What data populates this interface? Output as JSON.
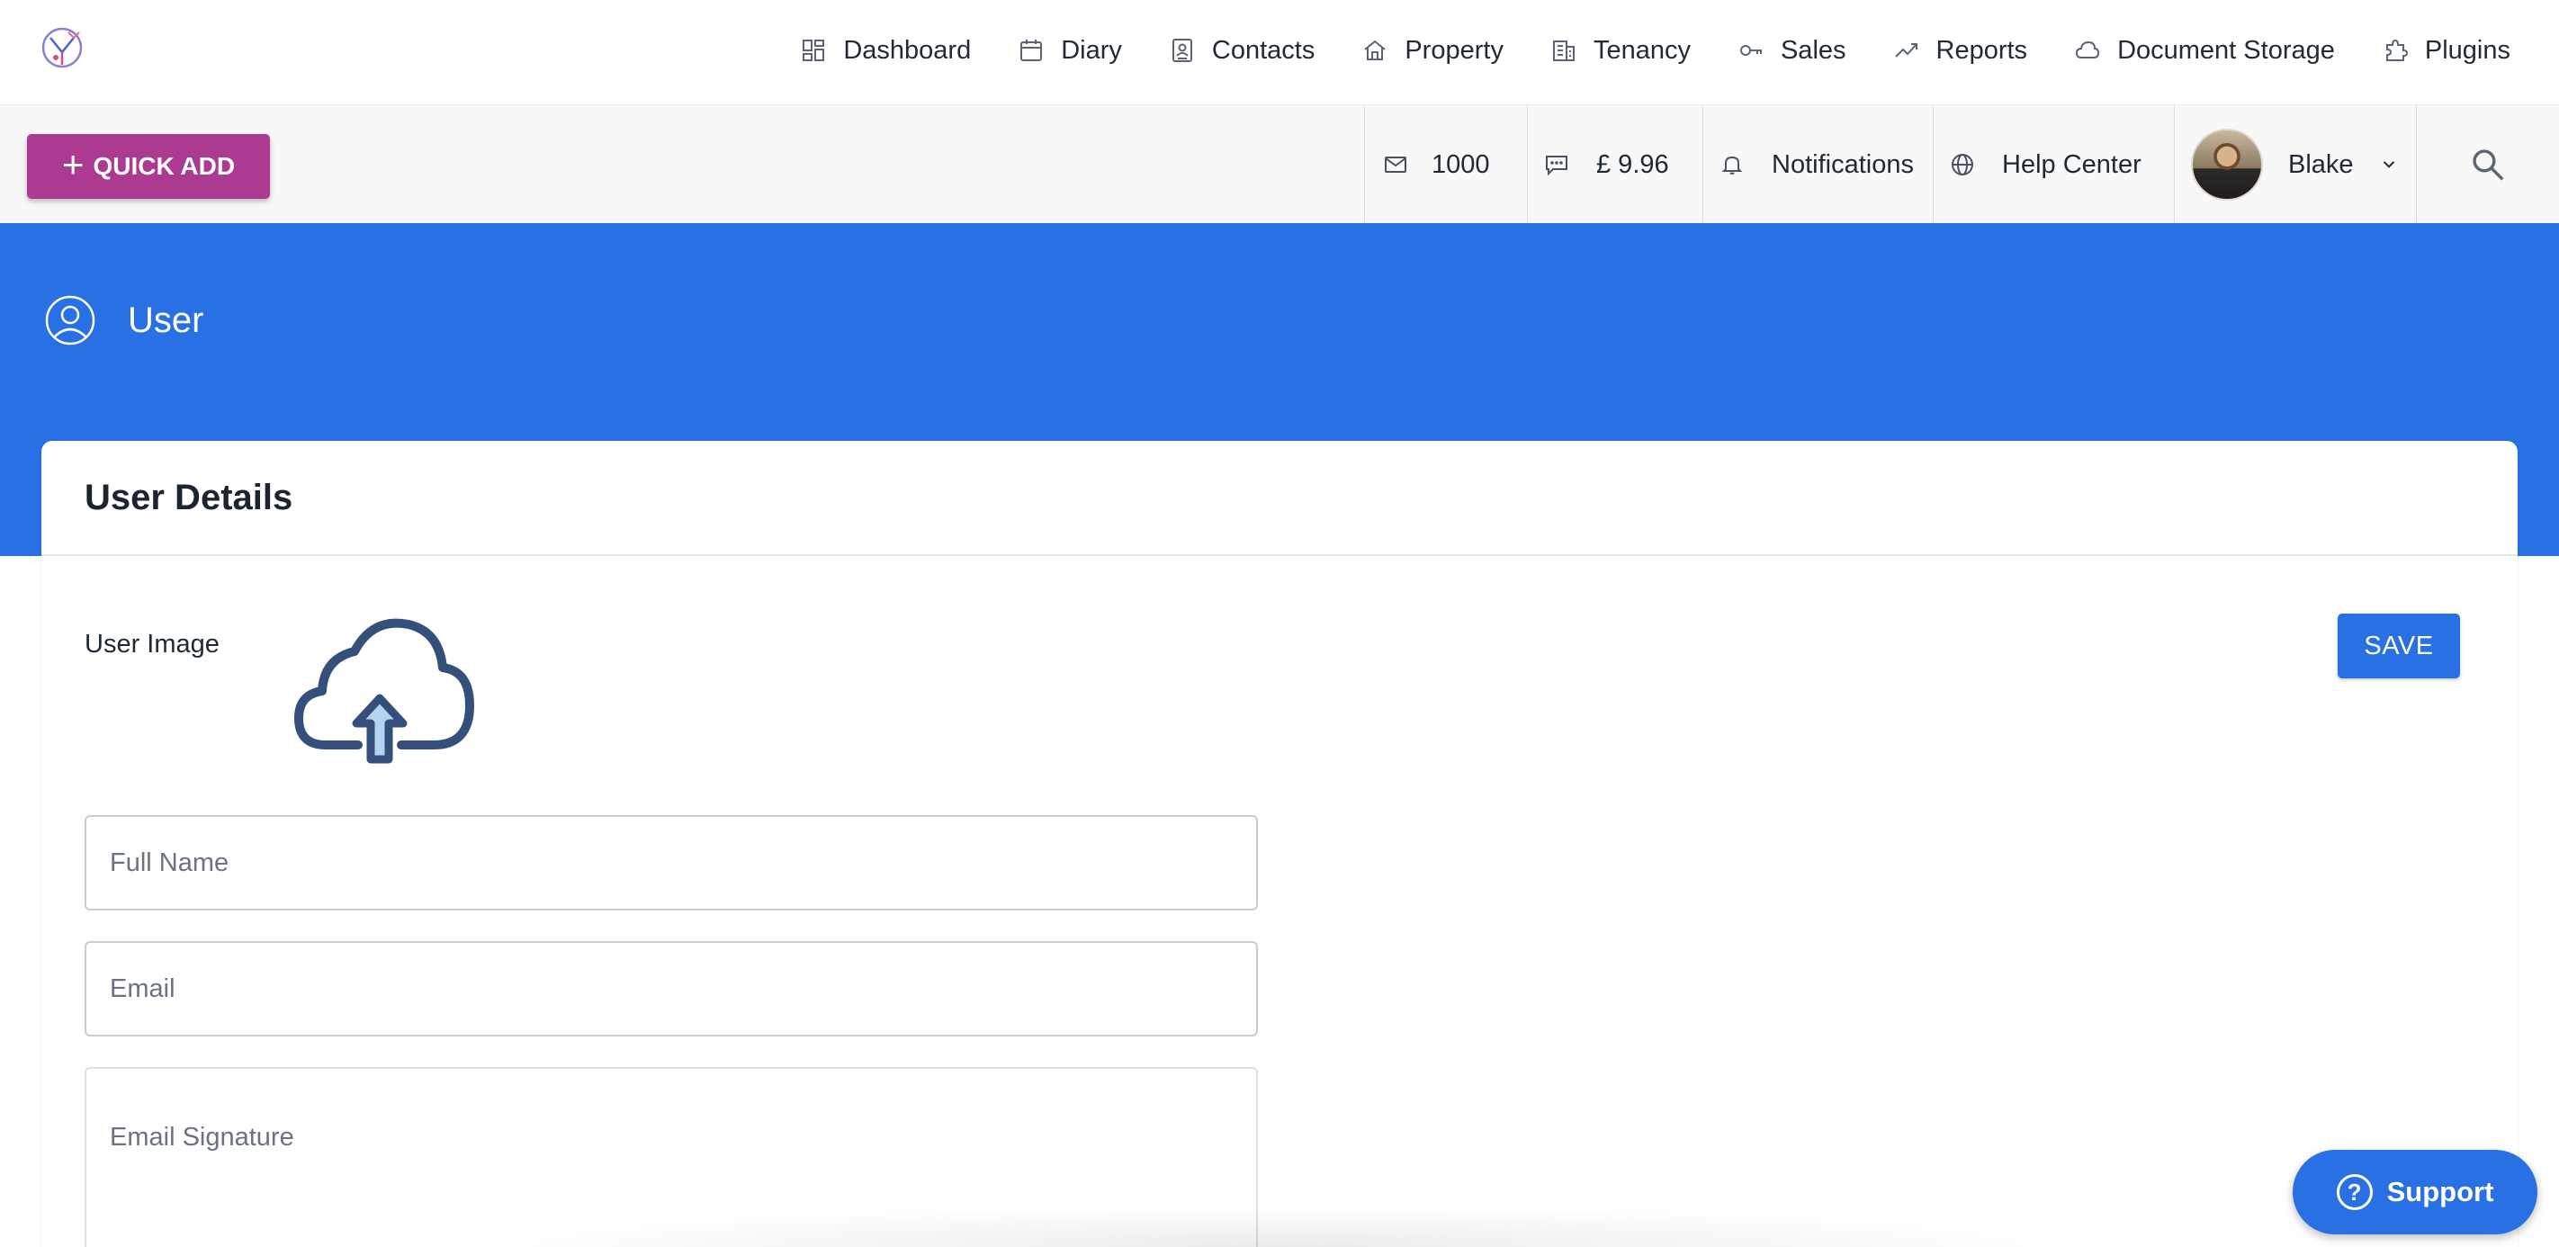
{
  "nav": {
    "items": [
      {
        "label": "Dashboard",
        "icon": "dashboard-icon"
      },
      {
        "label": "Diary",
        "icon": "calendar-icon"
      },
      {
        "label": "Contacts",
        "icon": "contact-card-icon"
      },
      {
        "label": "Property",
        "icon": "home-icon"
      },
      {
        "label": "Tenancy",
        "icon": "building-icon"
      },
      {
        "label": "Sales",
        "icon": "key-icon"
      },
      {
        "label": "Reports",
        "icon": "trending-up-icon"
      },
      {
        "label": "Document Storage",
        "icon": "cloud-icon"
      },
      {
        "label": "Plugins",
        "icon": "puzzle-icon"
      }
    ]
  },
  "toolbar": {
    "quick_add": "QUICK ADD",
    "email_credits": "1000",
    "sms_balance": "£ 9.96",
    "notifications": "Notifications",
    "help_center": "Help Center",
    "user_name": "Blake"
  },
  "hero": {
    "title": "User"
  },
  "card": {
    "title": "User Details",
    "user_image_label": "User Image",
    "save_label": "SAVE",
    "full_name_placeholder": "Full Name",
    "email_placeholder": "Email",
    "signature_placeholder": "Email Signature"
  },
  "support": {
    "label": "Support"
  },
  "colors": {
    "primary": "#2870e4",
    "quick_add": "#ac3a91",
    "upload_icon": "#34507a"
  }
}
